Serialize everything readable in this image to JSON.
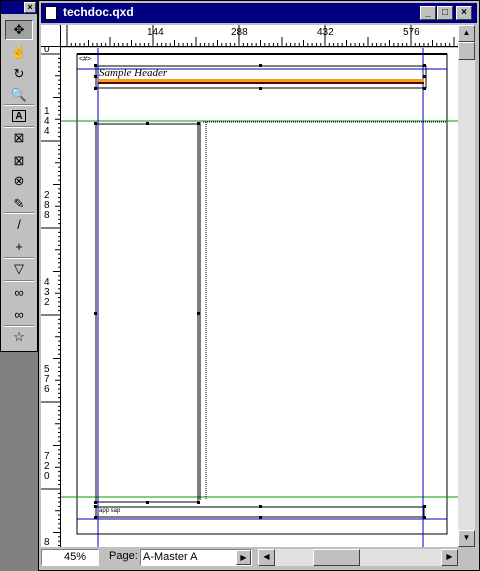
{
  "palette": {
    "close_label": "×",
    "tools": [
      {
        "name": "item-tool-icon",
        "glyph": "✥"
      },
      {
        "name": "content-tool-icon",
        "glyph": "☝"
      },
      {
        "name": "rotation-tool-icon",
        "glyph": "↻"
      },
      {
        "name": "zoom-tool-icon",
        "glyph": "🔍"
      },
      {
        "name": "text-box-tool-icon",
        "glyph": "A"
      },
      {
        "name": "picture-box-tool-icon",
        "glyph": "⊠"
      },
      {
        "name": "rect-picture-box-tool-icon",
        "glyph": "⊠"
      },
      {
        "name": "oval-picture-box-tool-icon",
        "glyph": "⊗"
      },
      {
        "name": "bezier-picture-box-tool-icon",
        "glyph": "✎"
      },
      {
        "name": "line-tool-icon",
        "glyph": "/"
      },
      {
        "name": "orthogonal-line-tool-icon",
        "glyph": "+"
      },
      {
        "name": "text-path-tool-icon",
        "glyph": "▽"
      },
      {
        "name": "linking-tool-icon",
        "glyph": "∞"
      },
      {
        "name": "unlinking-tool-icon",
        "glyph": "∞"
      },
      {
        "name": "star-tool-icon",
        "glyph": "☆"
      }
    ]
  },
  "window": {
    "title": "techdoc.qxd",
    "minimize": "_",
    "maximize": "□",
    "close": "×"
  },
  "ruler": {
    "h_labels": [
      "144",
      "288",
      "432",
      "576"
    ],
    "v_labels": [
      "0",
      "1 4 4",
      "2 8 8",
      "4 3 2",
      "5 7 6",
      "7 2 0",
      "8"
    ]
  },
  "document": {
    "header_text": "Sample Header",
    "page_number_text": "<#>",
    "footer_text": "app sap"
  },
  "status": {
    "zoom": "45%",
    "page_label": "Page:",
    "page_value": "A-Master A"
  },
  "colors": {
    "header_bar_orange": "#f0a020",
    "header_bar_dark": "#600000",
    "margin_blue": "#0000c0",
    "guide_green": "#00a000",
    "title_blue": "#000080"
  }
}
